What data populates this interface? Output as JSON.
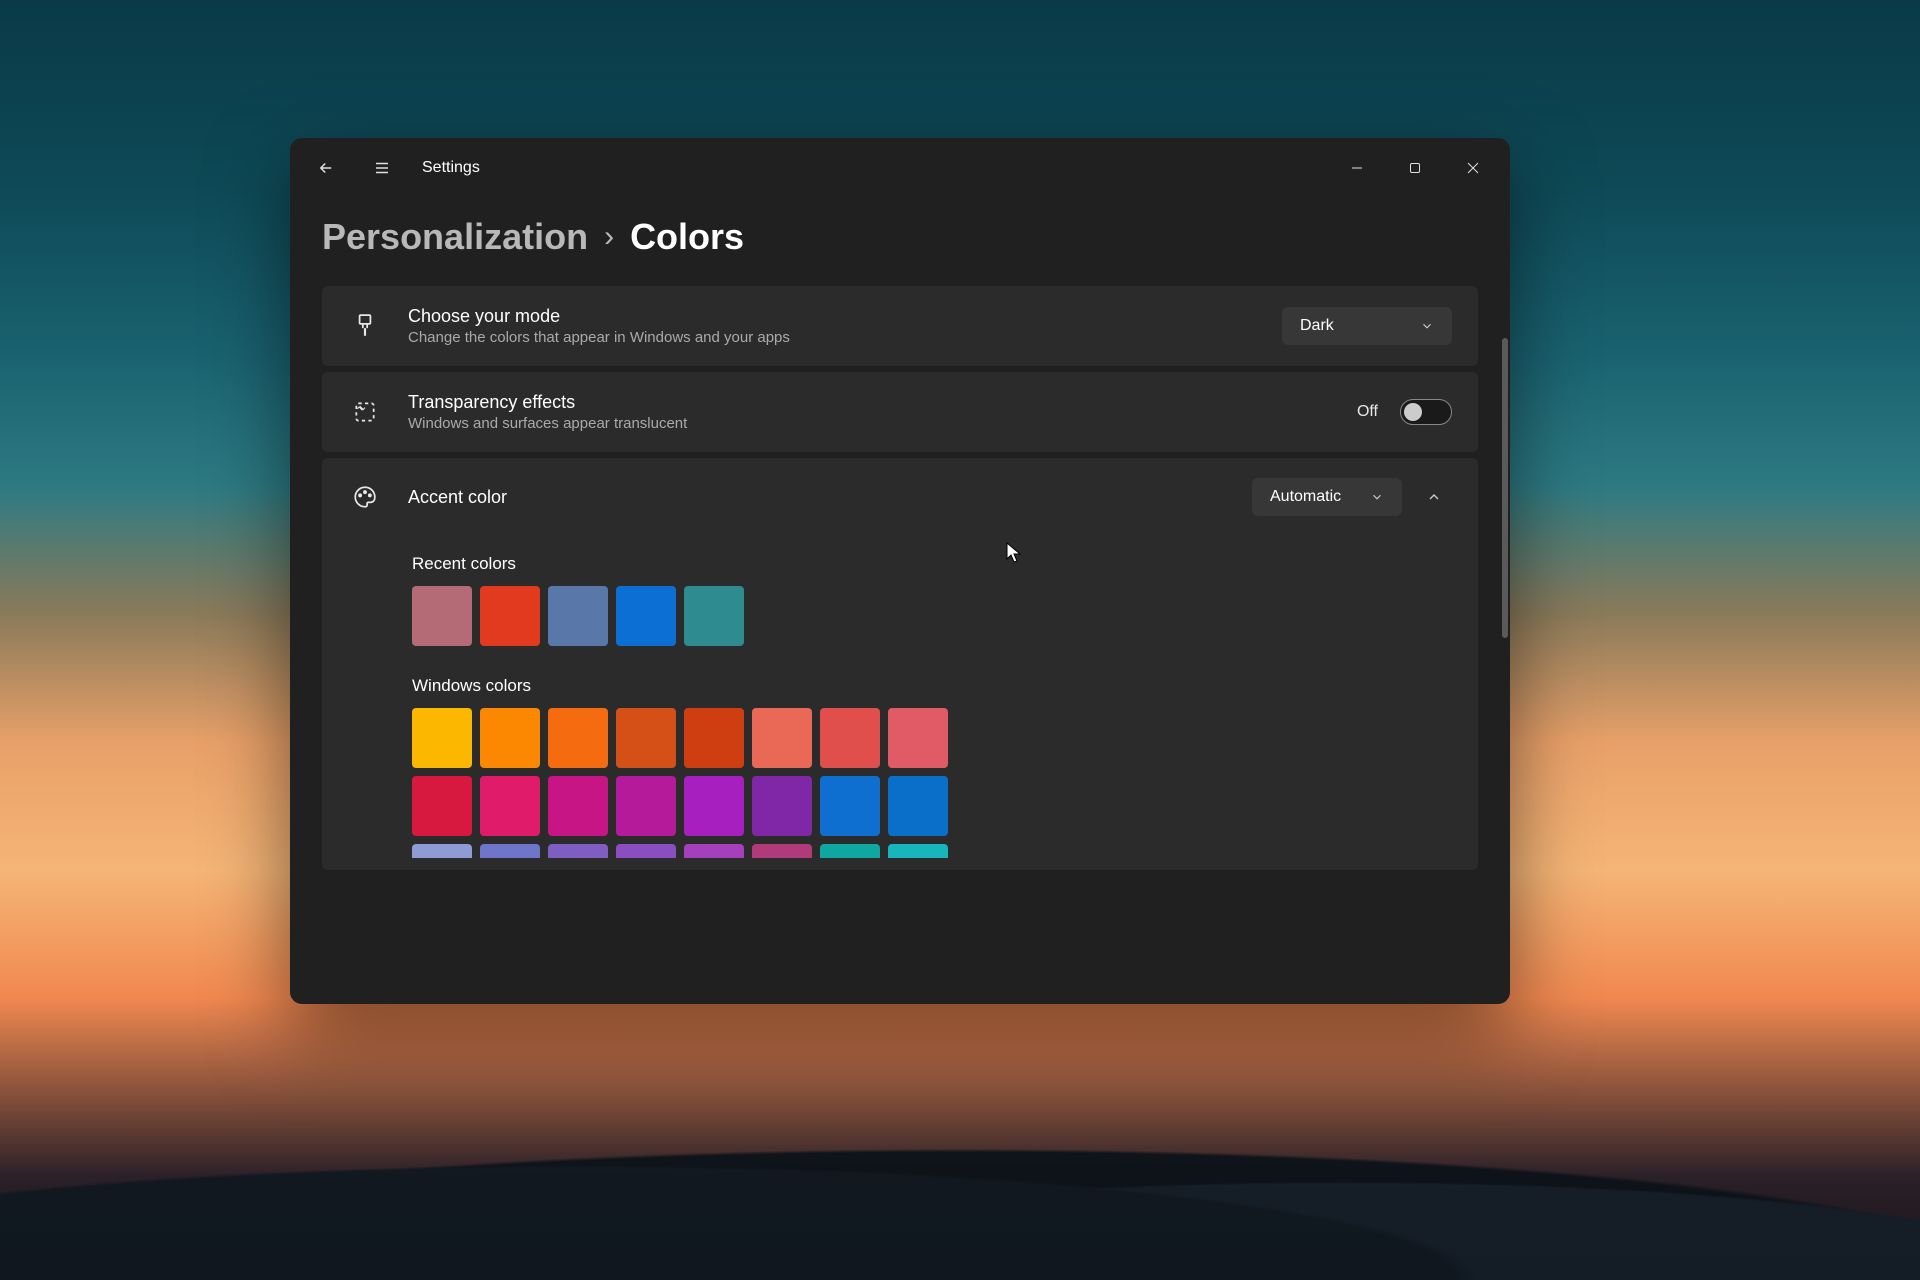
{
  "app": {
    "title": "Settings"
  },
  "breadcrumb": {
    "parent": "Personalization",
    "separator": "›",
    "current": "Colors"
  },
  "mode": {
    "title": "Choose your mode",
    "subtitle": "Change the colors that appear in Windows and your apps",
    "value": "Dark"
  },
  "transparency": {
    "title": "Transparency effects",
    "subtitle": "Windows and surfaces appear translucent",
    "state_label": "Off",
    "on": false
  },
  "accent": {
    "title": "Accent color",
    "value": "Automatic",
    "recent_label": "Recent colors",
    "recent_colors": [
      "#b46b75",
      "#e23a1e",
      "#5a77aa",
      "#0b6fd4",
      "#2e8b8f"
    ],
    "windows_label": "Windows colors",
    "windows_colors_row1": [
      "#fcb800",
      "#fb8800",
      "#f56c10",
      "#d55017",
      "#cf3e10",
      "#e96856",
      "#e04f4c",
      "#e05b66"
    ],
    "windows_colors_row2": [
      "#d7193f",
      "#e01b69",
      "#c71585",
      "#b51a9b",
      "#a81fbf",
      "#8027a8",
      "#0f6fd0",
      "#0a6fc8"
    ],
    "windows_colors_row3": [
      "#8e9bd6",
      "#6f76c9",
      "#7e5ec3",
      "#8b4ec0",
      "#a53fbc",
      "#b13a7a",
      "#0ea8a0",
      "#17b6bd"
    ]
  }
}
